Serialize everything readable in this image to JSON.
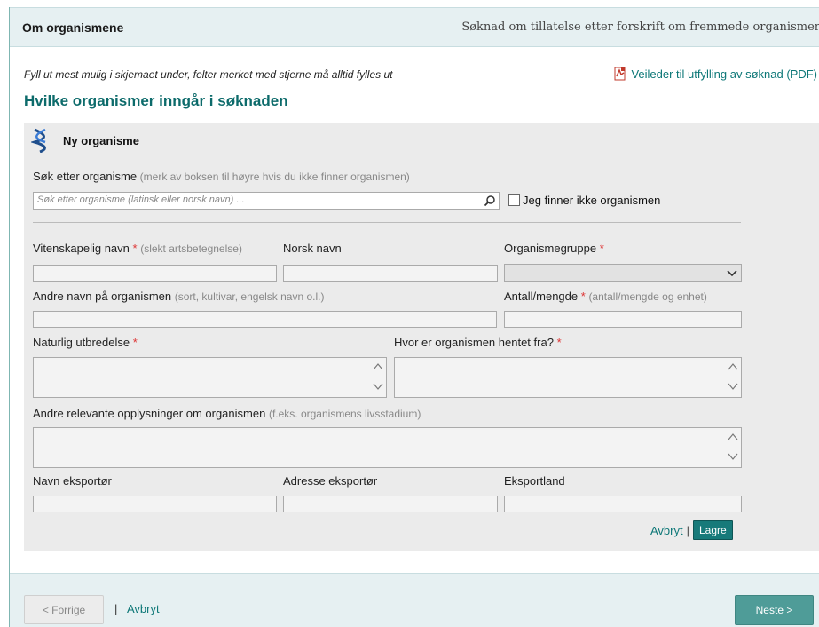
{
  "header": {
    "title": "Om organismene",
    "app_title": "Søknad om tillatelse etter forskrift om fremmede organismer"
  },
  "intro": {
    "instruction": "Fyll ut mest mulig i skjemaet under, felter merket med stjerne må alltid fylles ut",
    "pdf_link": "Veileder til utfylling av søknad (PDF)",
    "section_title": "Hvilke organismer inngår i søknaden"
  },
  "form": {
    "title": "Ny organisme",
    "search": {
      "label": "Søk etter organisme",
      "hint": "(merk av boksen til høyre hvis du ikke finner organismen)",
      "placeholder": "Søk etter organisme (latinsk eller norsk navn) ..."
    },
    "not_found_label": "Jeg finner ikke organismen",
    "fields": {
      "scientific_name": {
        "label": "Vitenskapelig navn",
        "req": "*",
        "hint": "(slekt artsbetegnelse)"
      },
      "norwegian_name": {
        "label": "Norsk navn"
      },
      "organism_group": {
        "label": "Organismegruppe",
        "req": "*"
      },
      "other_names": {
        "label": "Andre navn på organismen",
        "hint": "(sort, kultivar, engelsk navn o.l.)"
      },
      "quantity": {
        "label": "Antall/mengde",
        "req": "*",
        "hint": "(antall/mengde og enhet)"
      },
      "natural_range": {
        "label": "Naturlig utbredelse",
        "req": "*"
      },
      "origin": {
        "label": "Hvor er organismen hentet fra?",
        "req": "*"
      },
      "other_info": {
        "label": "Andre relevante opplysninger om organismen",
        "hint": "(f.eks. organismens livsstadium)"
      },
      "exporter_name": {
        "label": "Navn eksportør"
      },
      "exporter_address": {
        "label": "Adresse eksportør"
      },
      "export_country": {
        "label": "Eksportland"
      }
    },
    "actions": {
      "cancel": "Avbryt",
      "separator": "|",
      "save": "Lagre"
    }
  },
  "footer": {
    "prev": "< Forrige",
    "separator": "|",
    "cancel": "Avbryt",
    "next": "Neste >"
  },
  "colors": {
    "accent": "#0d7777",
    "header_bg": "#e6f0f2",
    "panel_bg": "#ebebeb",
    "required": "#d33333",
    "next_button": "#4f9c98"
  },
  "icons": [
    "pdf-icon",
    "dna-icon",
    "search-icon",
    "chevron-down-icon",
    "scroll-up-icon",
    "scroll-down-icon"
  ]
}
